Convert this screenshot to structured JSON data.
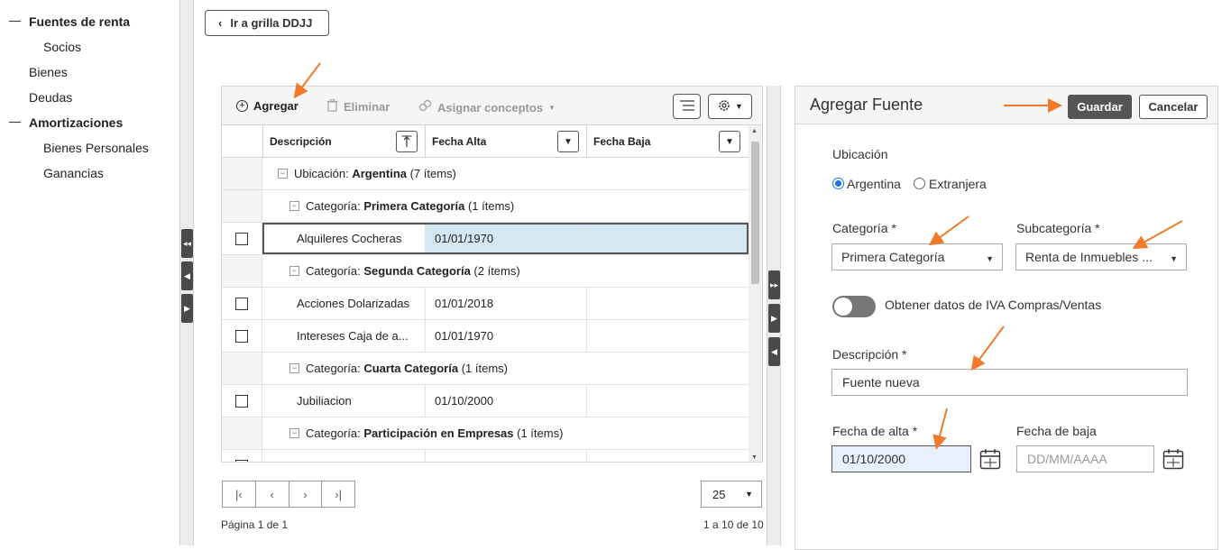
{
  "sidebar": {
    "items": [
      {
        "label": "Fuentes de renta",
        "group": true
      },
      {
        "label": "Socios",
        "group": false
      },
      {
        "label": "Bienes",
        "group": false
      },
      {
        "label": "Deudas",
        "group": false
      },
      {
        "label": "Amortizaciones",
        "group": true
      },
      {
        "label": "Bienes Personales",
        "group": false
      },
      {
        "label": "Ganancias",
        "group": false
      }
    ]
  },
  "top": {
    "back_button": "Ir a grilla DDJJ"
  },
  "toolbar": {
    "add_label": "Agregar",
    "delete_label": "Eliminar",
    "assign_label": "Asignar conceptos"
  },
  "grid": {
    "columns": [
      "Descripción",
      "Fecha Alta",
      "Fecha Baja"
    ],
    "rows": [
      {
        "kind": "group1",
        "prefix": "Ubicación: ",
        "name": "Argentina",
        "count": " (7 ítems)"
      },
      {
        "kind": "group2",
        "prefix": "Categoría: ",
        "name": "Primera Categoría",
        "count": " (1 ítems)"
      },
      {
        "kind": "data",
        "desc": "Alquileres Cocheras",
        "alta": "01/01/1970",
        "baja": "",
        "selected": true
      },
      {
        "kind": "group2",
        "prefix": "Categoría: ",
        "name": "Segunda Categoría",
        "count": " (2 ítems)"
      },
      {
        "kind": "data",
        "desc": "Acciones Dolarizadas",
        "alta": "01/01/2018",
        "baja": ""
      },
      {
        "kind": "data",
        "desc": "Intereses Caja de a...",
        "alta": "01/01/1970",
        "baja": ""
      },
      {
        "kind": "group2",
        "prefix": "Categoría: ",
        "name": "Cuarta Categoría",
        "count": " (1 ítems)"
      },
      {
        "kind": "data",
        "desc": "Jubiliacion",
        "alta": "01/10/2000",
        "baja": ""
      },
      {
        "kind": "group2",
        "prefix": "Categoría: ",
        "name": "Participación en Empresas",
        "count": " (1 ítems)"
      },
      {
        "kind": "data",
        "desc": "",
        "alta": "",
        "baja": ""
      }
    ]
  },
  "pager": {
    "page_size": "25",
    "page_info": "Página 1 de 1",
    "range_info": "1 a 10 de 10"
  },
  "form": {
    "title": "Agregar Fuente",
    "save_label": "Guardar",
    "cancel_label": "Cancelar",
    "location_label": "Ubicación",
    "location_options": [
      "Argentina",
      "Extranjera"
    ],
    "location_selected": "Argentina",
    "category_label": "Categoría *",
    "category_value": "Primera Categoría",
    "subcategory_label": "Subcategoría *",
    "subcategory_value": "Renta de Inmuebles ...",
    "iva_toggle_label": "Obtener datos de IVA Compras/Ventas",
    "iva_toggle_on": false,
    "description_label": "Descripción *",
    "description_value": "Fuente nueva",
    "date_alta_label": "Fecha de alta *",
    "date_alta_value": "01/10/2000",
    "date_baja_label": "Fecha de baja",
    "date_baja_placeholder": "DD/MM/AAAA"
  },
  "colors": {
    "annotation_arrow": "#f07a2a",
    "primary_button": "#555555",
    "selection": "#d4e8f2",
    "focus_input": "#e8f0fe"
  }
}
